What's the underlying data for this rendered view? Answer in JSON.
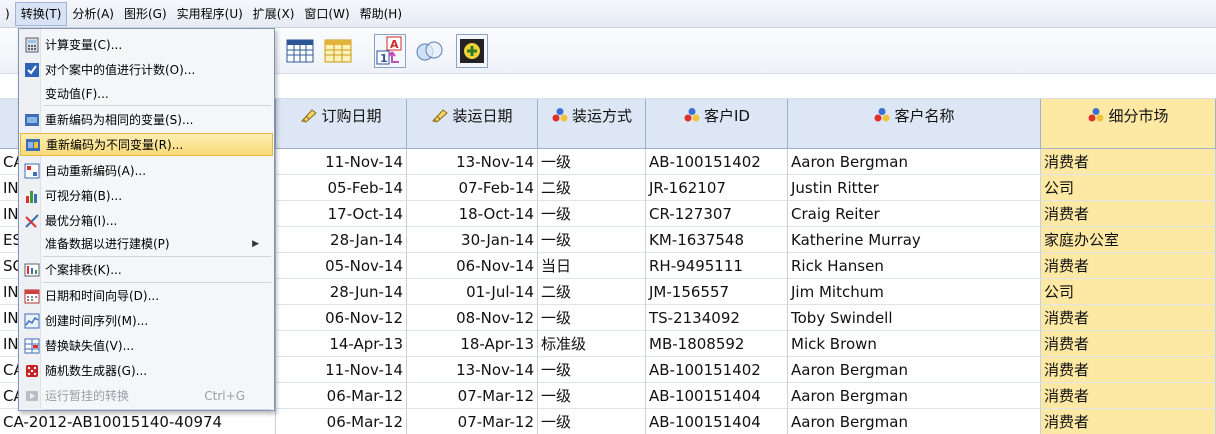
{
  "menubar": {
    "items": [
      ")",
      "转换(T)",
      "分析(A)",
      "图形(G)",
      "实用程序(U)",
      "扩展(X)",
      "窗口(W)",
      "帮助(H)"
    ],
    "active_index": 1
  },
  "menu": {
    "items": [
      {
        "label": "计算变量(C)...",
        "icon": "calculator-icon"
      },
      {
        "label": "对个案中的值进行计数(O)...",
        "icon": "count-values-icon"
      },
      {
        "label": "变动值(F)...",
        "icon": ""
      },
      {
        "label": "重新编码为相同的变量(S)...",
        "icon": "recode-same-icon"
      },
      {
        "label": "重新编码为不同变量(R)...",
        "icon": "recode-different-icon",
        "highlighted": true
      },
      {
        "label": "自动重新编码(A)...",
        "icon": "auto-recode-icon"
      },
      {
        "label": "可视分箱(B)...",
        "icon": "visual-binning-icon"
      },
      {
        "label": "最优分箱(I)...",
        "icon": "optimal-binning-icon"
      },
      {
        "label": "准备数据以进行建模(P)",
        "icon": "",
        "submenu": true
      },
      {
        "label": "个案排秩(K)...",
        "icon": "rank-cases-icon"
      },
      {
        "label": "日期和时间向导(D)...",
        "icon": "date-time-wizard-icon"
      },
      {
        "label": "创建时间序列(M)...",
        "icon": "time-series-icon"
      },
      {
        "label": "替换缺失值(V)...",
        "icon": "replace-missing-icon"
      },
      {
        "label": "随机数生成器(G)...",
        "icon": "dice-icon"
      },
      {
        "label": "运行暂挂的转换",
        "icon": "run-pending-icon",
        "disabled": true,
        "shortcut": "Ctrl+G"
      }
    ]
  },
  "grid": {
    "columns": [
      {
        "label": "",
        "icon": ""
      },
      {
        "label": "订购日期",
        "icon": "date-variable-icon"
      },
      {
        "label": "装运日期",
        "icon": "date-variable-icon"
      },
      {
        "label": "装运方式",
        "icon": "nominal-variable-icon"
      },
      {
        "label": "客户ID",
        "icon": "nominal-variable-icon"
      },
      {
        "label": "客户名称",
        "icon": "nominal-variable-icon"
      },
      {
        "label": "细分市场",
        "icon": "nominal-variable-icon",
        "selected": true
      }
    ],
    "rows": [
      [
        "CA",
        "11-Nov-14",
        "13-Nov-14",
        "一级",
        "AB-100151402",
        "Aaron Bergman",
        "消费者"
      ],
      [
        "IN",
        "05-Feb-14",
        "07-Feb-14",
        "二级",
        "JR-162107",
        "Justin Ritter",
        "公司"
      ],
      [
        "IN",
        "17-Oct-14",
        "18-Oct-14",
        "一级",
        "CR-127307",
        "Craig Reiter",
        "消费者"
      ],
      [
        "ES",
        "28-Jan-14",
        "30-Jan-14",
        "一级",
        "KM-1637548",
        "Katherine Murray",
        "家庭办公室"
      ],
      [
        "SG",
        "05-Nov-14",
        "06-Nov-14",
        "当日",
        "RH-9495111",
        "Rick Hansen",
        "消费者"
      ],
      [
        "IN",
        "28-Jun-14",
        "01-Jul-14",
        "二级",
        "JM-156557",
        "Jim Mitchum",
        "公司"
      ],
      [
        "IN",
        "06-Nov-12",
        "08-Nov-12",
        "一级",
        "TS-2134092",
        "Toby Swindell",
        "消费者"
      ],
      [
        "IN",
        "14-Apr-13",
        "18-Apr-13",
        "标准级",
        "MB-1808592",
        "Mick Brown",
        "消费者"
      ],
      [
        "CA",
        "11-Nov-14",
        "13-Nov-14",
        "一级",
        "AB-100151402",
        "Aaron Bergman",
        "消费者"
      ],
      [
        "CA",
        "06-Mar-12",
        "07-Mar-12",
        "一级",
        "AB-100151404",
        "Aaron Bergman",
        "消费者"
      ],
      [
        "CA-2012-AB10015140-40974",
        "06-Mar-12",
        "07-Mar-12",
        "一级",
        "AB-100151404",
        "Aaron Bergman",
        "消费者"
      ]
    ]
  }
}
